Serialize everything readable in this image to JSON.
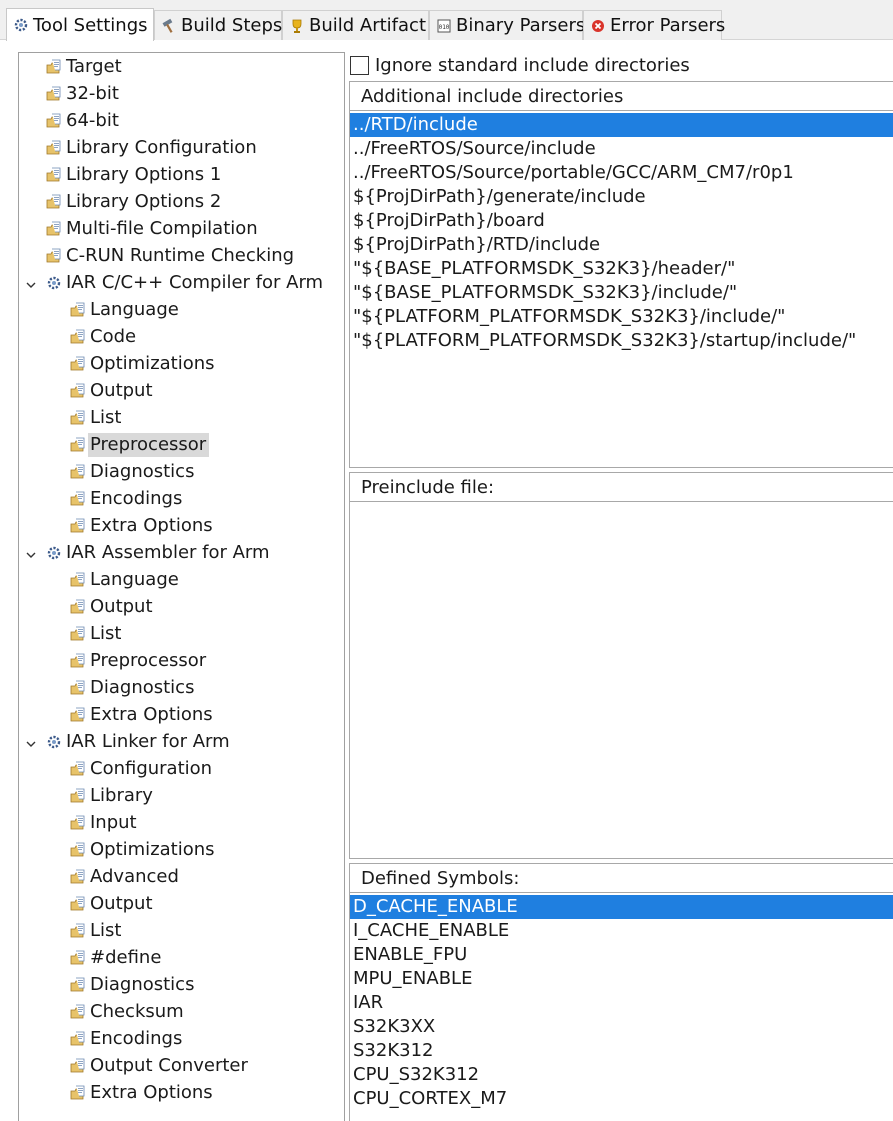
{
  "tabs": [
    {
      "label": "Tool Settings",
      "icon": "settings-gear-icon",
      "active": true
    },
    {
      "label": "Build Steps",
      "icon": "hammer-icon",
      "active": false
    },
    {
      "label": "Build Artifact",
      "icon": "trophy-icon",
      "active": false
    },
    {
      "label": "Binary Parsers",
      "icon": "binary-file-icon",
      "active": false
    },
    {
      "label": "Error Parsers",
      "icon": "error-icon",
      "active": false
    }
  ],
  "tree": {
    "nodes": [
      {
        "label": "Target",
        "level": 0,
        "expandable": false
      },
      {
        "label": "32-bit",
        "level": 0,
        "expandable": false
      },
      {
        "label": "64-bit",
        "level": 0,
        "expandable": false
      },
      {
        "label": "Library Configuration",
        "level": 0,
        "expandable": false
      },
      {
        "label": "Library Options 1",
        "level": 0,
        "expandable": false
      },
      {
        "label": "Library Options 2",
        "level": 0,
        "expandable": false
      },
      {
        "label": "Multi-file Compilation",
        "level": 0,
        "expandable": false
      },
      {
        "label": "C-RUN Runtime Checking",
        "level": 0,
        "expandable": false
      },
      {
        "label": "IAR C/C++ Compiler for Arm",
        "level": 0,
        "expandable": true
      },
      {
        "label": "Language",
        "level": 1,
        "expandable": false
      },
      {
        "label": "Code",
        "level": 1,
        "expandable": false
      },
      {
        "label": "Optimizations",
        "level": 1,
        "expandable": false
      },
      {
        "label": "Output",
        "level": 1,
        "expandable": false
      },
      {
        "label": "List",
        "level": 1,
        "expandable": false
      },
      {
        "label": "Preprocessor",
        "level": 1,
        "expandable": false,
        "selected": true
      },
      {
        "label": "Diagnostics",
        "level": 1,
        "expandable": false
      },
      {
        "label": "Encodings",
        "level": 1,
        "expandable": false
      },
      {
        "label": "Extra Options",
        "level": 1,
        "expandable": false
      },
      {
        "label": "IAR Assembler for Arm",
        "level": 0,
        "expandable": true
      },
      {
        "label": "Language",
        "level": 1,
        "expandable": false
      },
      {
        "label": "Output",
        "level": 1,
        "expandable": false
      },
      {
        "label": "List",
        "level": 1,
        "expandable": false
      },
      {
        "label": "Preprocessor",
        "level": 1,
        "expandable": false
      },
      {
        "label": "Diagnostics",
        "level": 1,
        "expandable": false
      },
      {
        "label": "Extra Options",
        "level": 1,
        "expandable": false
      },
      {
        "label": "IAR Linker for Arm",
        "level": 0,
        "expandable": true
      },
      {
        "label": "Configuration",
        "level": 1,
        "expandable": false
      },
      {
        "label": "Library",
        "level": 1,
        "expandable": false
      },
      {
        "label": "Input",
        "level": 1,
        "expandable": false
      },
      {
        "label": "Optimizations",
        "level": 1,
        "expandable": false
      },
      {
        "label": "Advanced",
        "level": 1,
        "expandable": false
      },
      {
        "label": "Output",
        "level": 1,
        "expandable": false
      },
      {
        "label": "List",
        "level": 1,
        "expandable": false
      },
      {
        "label": "#define",
        "level": 1,
        "expandable": false
      },
      {
        "label": "Diagnostics",
        "level": 1,
        "expandable": false
      },
      {
        "label": "Checksum",
        "level": 1,
        "expandable": false
      },
      {
        "label": "Encodings",
        "level": 1,
        "expandable": false
      },
      {
        "label": "Output Converter",
        "level": 1,
        "expandable": false
      },
      {
        "label": "Extra Options",
        "level": 1,
        "expandable": false
      }
    ]
  },
  "settings": {
    "ignore_std_label": "Ignore standard include directories",
    "ignore_std_checked": false,
    "include_dirs": {
      "title": "Additional include directories",
      "items": [
        "../RTD/include",
        "../FreeRTOS/Source/include",
        "../FreeRTOS/Source/portable/GCC/ARM_CM7/r0p1",
        "${ProjDirPath}/generate/include",
        "${ProjDirPath}/board",
        "${ProjDirPath}/RTD/include",
        "\"${BASE_PLATFORMSDK_S32K3}/header/\"",
        "\"${BASE_PLATFORMSDK_S32K3}/include/\"",
        "\"${PLATFORM_PLATFORMSDK_S32K3}/include/\"",
        "\"${PLATFORM_PLATFORMSDK_S32K3}/startup/include/\""
      ],
      "selected_index": 0
    },
    "preinclude": {
      "title": "Preinclude file:",
      "items": []
    },
    "defined_symbols": {
      "title": "Defined Symbols:",
      "items": [
        "D_CACHE_ENABLE",
        "I_CACHE_ENABLE",
        "ENABLE_FPU",
        "MPU_ENABLE",
        "IAR",
        "S32K3XX",
        "S32K312",
        "CPU_S32K312",
        "CPU_CORTEX_M7"
      ],
      "selected_index": 0
    }
  },
  "colors": {
    "selection_blue": "#1f7fe0",
    "tree_selection_gray": "#d9d9d9",
    "error_red": "#d9342b"
  }
}
